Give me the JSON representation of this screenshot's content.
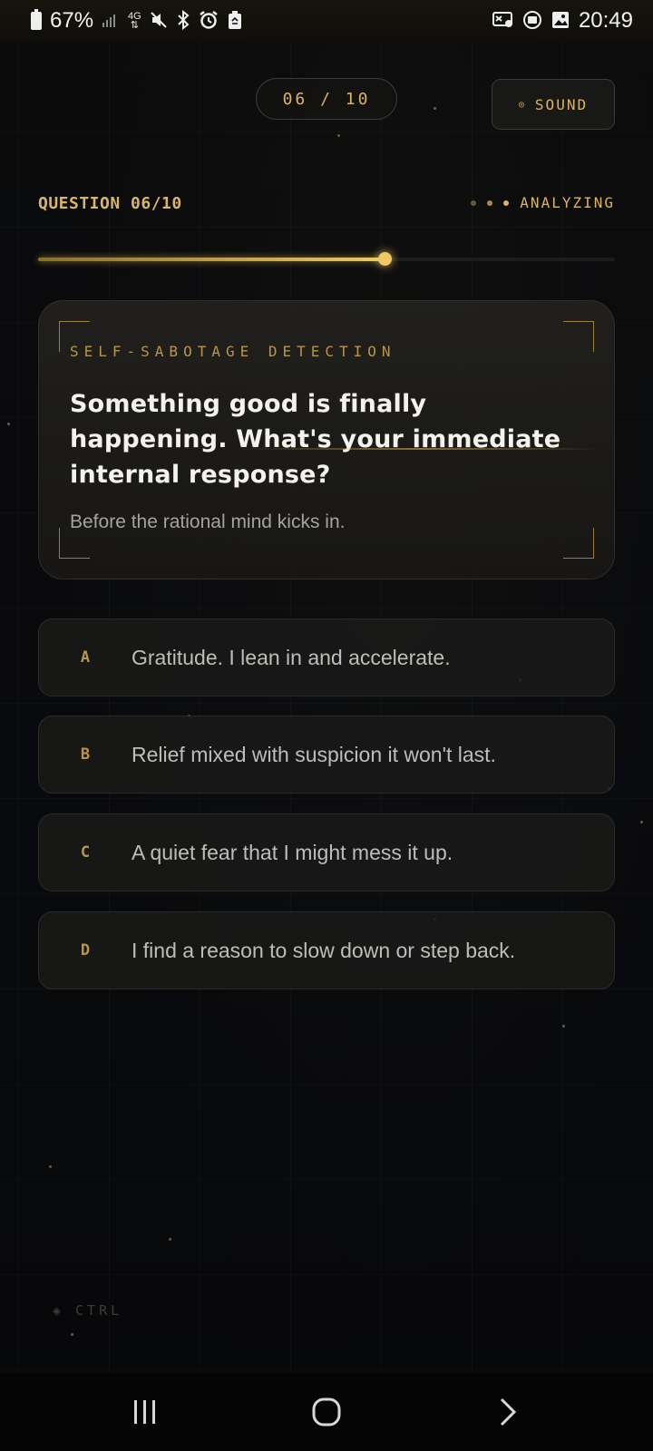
{
  "status_bar": {
    "battery": "67%",
    "time": "20:49"
  },
  "header": {
    "counter": "06 / 10",
    "sound_label": "SOUND"
  },
  "progress": {
    "question_label": "QUESTION 06/10",
    "status": "ANALYZING",
    "fraction": 0.6
  },
  "card": {
    "tag": "SELF-SABOTAGE DETECTION",
    "question": "Something good is finally happening. What's your immediate internal response?",
    "subtitle": "Before the rational mind kicks in."
  },
  "options": [
    {
      "letter": "A",
      "text": "Gratitude. I lean in and accelerate."
    },
    {
      "letter": "B",
      "text": "Relief mixed with suspicion it won't last."
    },
    {
      "letter": "C",
      "text": "A quiet fear that I might mess it up."
    },
    {
      "letter": "D",
      "text": "I find a reason to slow down or step back."
    }
  ],
  "footer": {
    "ctrl_label": "CTRL"
  },
  "colors": {
    "accent": "#d9b564",
    "background": "#08090b"
  }
}
